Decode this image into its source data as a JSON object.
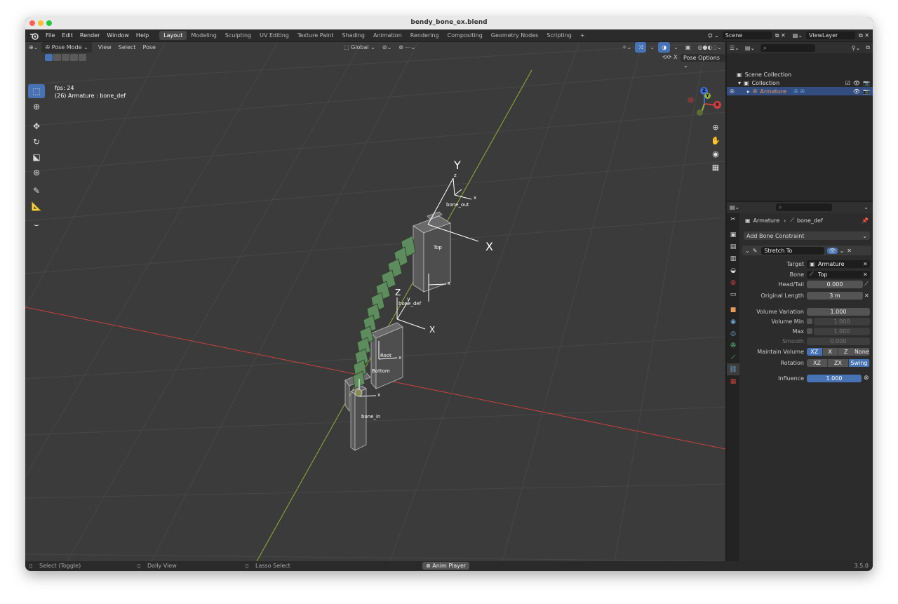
{
  "window": {
    "title": "bendy_bone_ex.blend"
  },
  "menu": {
    "items": [
      "File",
      "Edit",
      "Render",
      "Window",
      "Help"
    ],
    "workspaces": [
      "Layout",
      "Modeling",
      "Sculpting",
      "UV Editing",
      "Texture Paint",
      "Shading",
      "Animation",
      "Rendering",
      "Compositing",
      "Geometry Nodes",
      "Scripting"
    ],
    "active_workspace": "Layout",
    "add_tab": "+",
    "scene": "Scene",
    "view_layer": "ViewLayer"
  },
  "viewport": {
    "mode": "Pose Mode",
    "menus": [
      "View",
      "Select",
      "Pose"
    ],
    "transform": "Global",
    "pose_options": "Pose Options",
    "fps": "fps: 24",
    "object_info": "(26) Armature : bone_def",
    "bone_labels": {
      "bone_out": "bone_out",
      "top": "Top",
      "bone_def": "bone_def",
      "root": "Root",
      "bottom": "Bottom",
      "bone_in": "bone_in"
    },
    "axes": {
      "x": "X",
      "y": "Y",
      "z": "Z",
      "x_small": "x",
      "y_small": "y",
      "z_small": "z"
    },
    "gizmo": {
      "x": "X",
      "y": "Y",
      "z": "Z"
    }
  },
  "outliner": {
    "scene_collection": "Scene Collection",
    "collection": "Collection",
    "armature": "Armature"
  },
  "properties": {
    "breadcrumb_object": "Armature",
    "breadcrumb_bone": "bone_def",
    "add_constraint": "Add Bone Constraint",
    "constraint_name": "Stretch To",
    "fields": {
      "target_label": "Target",
      "target_value": "Armature",
      "bone_label": "Bone",
      "bone_value": "Top",
      "headtail_label": "Head/Tail",
      "headtail_value": "0.000",
      "origlen_label": "Original Length",
      "origlen_value": "3 m",
      "volvar_label": "Volume Variation",
      "volvar_value": "1.000",
      "volmin_label": "Volume Min",
      "volmin_value": "1.000",
      "max_label": "Max",
      "max_value": "1.000",
      "smooth_label": "Smooth",
      "smooth_value": "0.000",
      "maintain_label": "Maintain Volume",
      "rotation_label": "Rotation",
      "influence_label": "Influence",
      "influence_value": "1.000"
    },
    "maintain_options": [
      "XZ",
      "X",
      "Z",
      "None"
    ],
    "maintain_selected": "XZ",
    "rotation_options": [
      "XZ",
      "ZX",
      "Swing"
    ],
    "rotation_selected": "Swing"
  },
  "status": {
    "select": "Select (Toggle)",
    "dolly": "Dolly View",
    "lasso": "Lasso Select",
    "anim": "Anim Player",
    "version": "3.5.0"
  },
  "colors": {
    "accent": "#4772b3",
    "bone_green": "#5e8c5e",
    "x_axis": "#c8403f",
    "y_axis": "#8fae3c"
  }
}
